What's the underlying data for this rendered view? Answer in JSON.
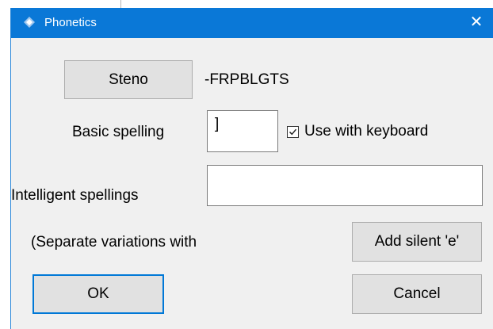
{
  "dialog": {
    "title": "Phonetics",
    "close_glyph": "✕",
    "steno_button": "Steno",
    "steno_value": "-FRPBLGTS",
    "basic_spelling_label": "Basic spelling",
    "basic_spelling_value": "]",
    "use_with_keyboard_label": "Use with keyboard",
    "use_with_keyboard_checked": true,
    "intelligent_spellings_label": "Intelligent spellings",
    "intelligent_spellings_value": "",
    "separate_note": "(Separate variations with",
    "add_silent_e_button": "Add silent 'e'",
    "ok_button": "OK",
    "cancel_button": "Cancel"
  },
  "colors": {
    "titlebar": "#0a78d7",
    "window_bg": "#f0f0f0",
    "button_bg": "#e1e1e1",
    "default_button_border": "#0078d7"
  },
  "icons": {
    "app": "app-diamond-icon",
    "close": "close-icon",
    "check": "checkmark-icon"
  }
}
